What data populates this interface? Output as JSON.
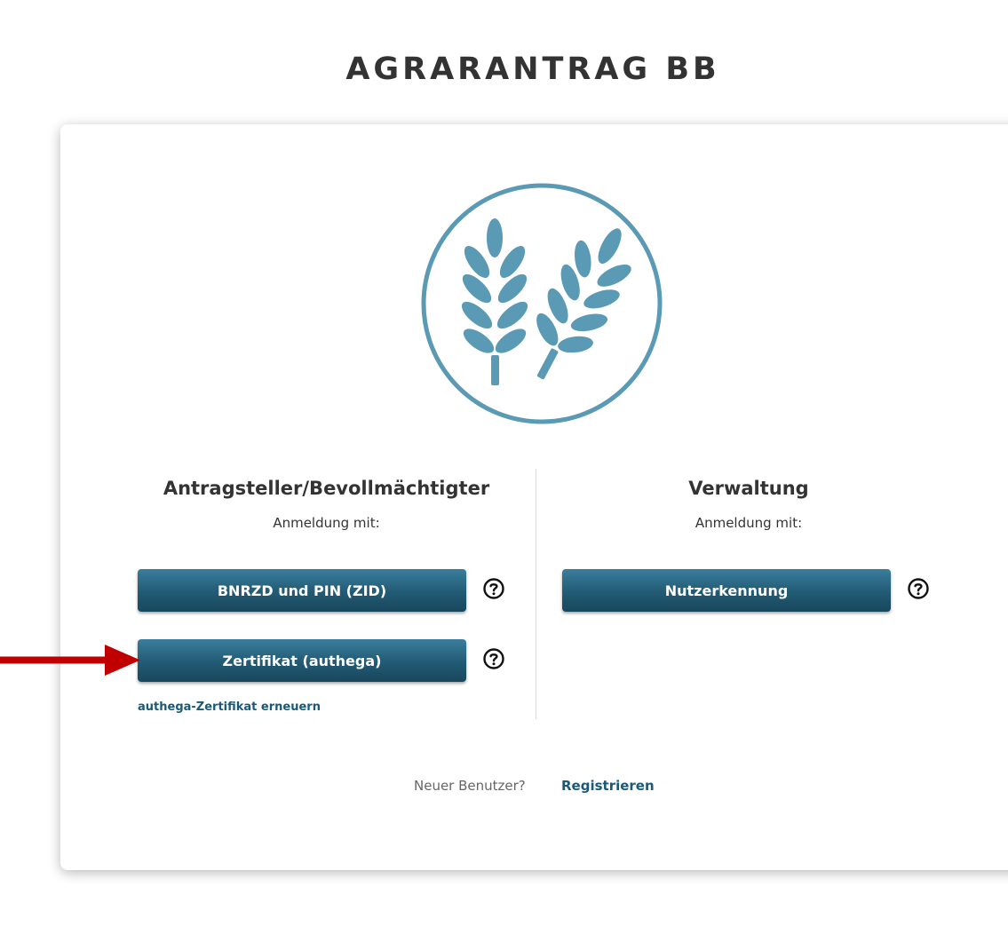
{
  "header": {
    "title": "AGRARANTRAG BB"
  },
  "logo": {
    "icon": "wheat-icon",
    "color": "#5a9ab5"
  },
  "left_column": {
    "heading": "Antragsteller/Bevollmächtigter",
    "subheading": "Anmeldung mit:",
    "buttons": [
      {
        "label": "BNRZD und PIN (ZID)"
      },
      {
        "label": "Zertifikat (authega)"
      }
    ],
    "renew_link": "authega-Zertifikat erneuern"
  },
  "right_column": {
    "heading": "Verwaltung",
    "subheading": "Anmeldung mit:",
    "buttons": [
      {
        "label": "Nutzerkennung"
      }
    ]
  },
  "footer": {
    "question": "Neuer Benutzer?",
    "register_link": "Registrieren"
  },
  "colors": {
    "button": "#225a74",
    "link": "#1a5a78",
    "annotation_arrow": "#c00000"
  }
}
